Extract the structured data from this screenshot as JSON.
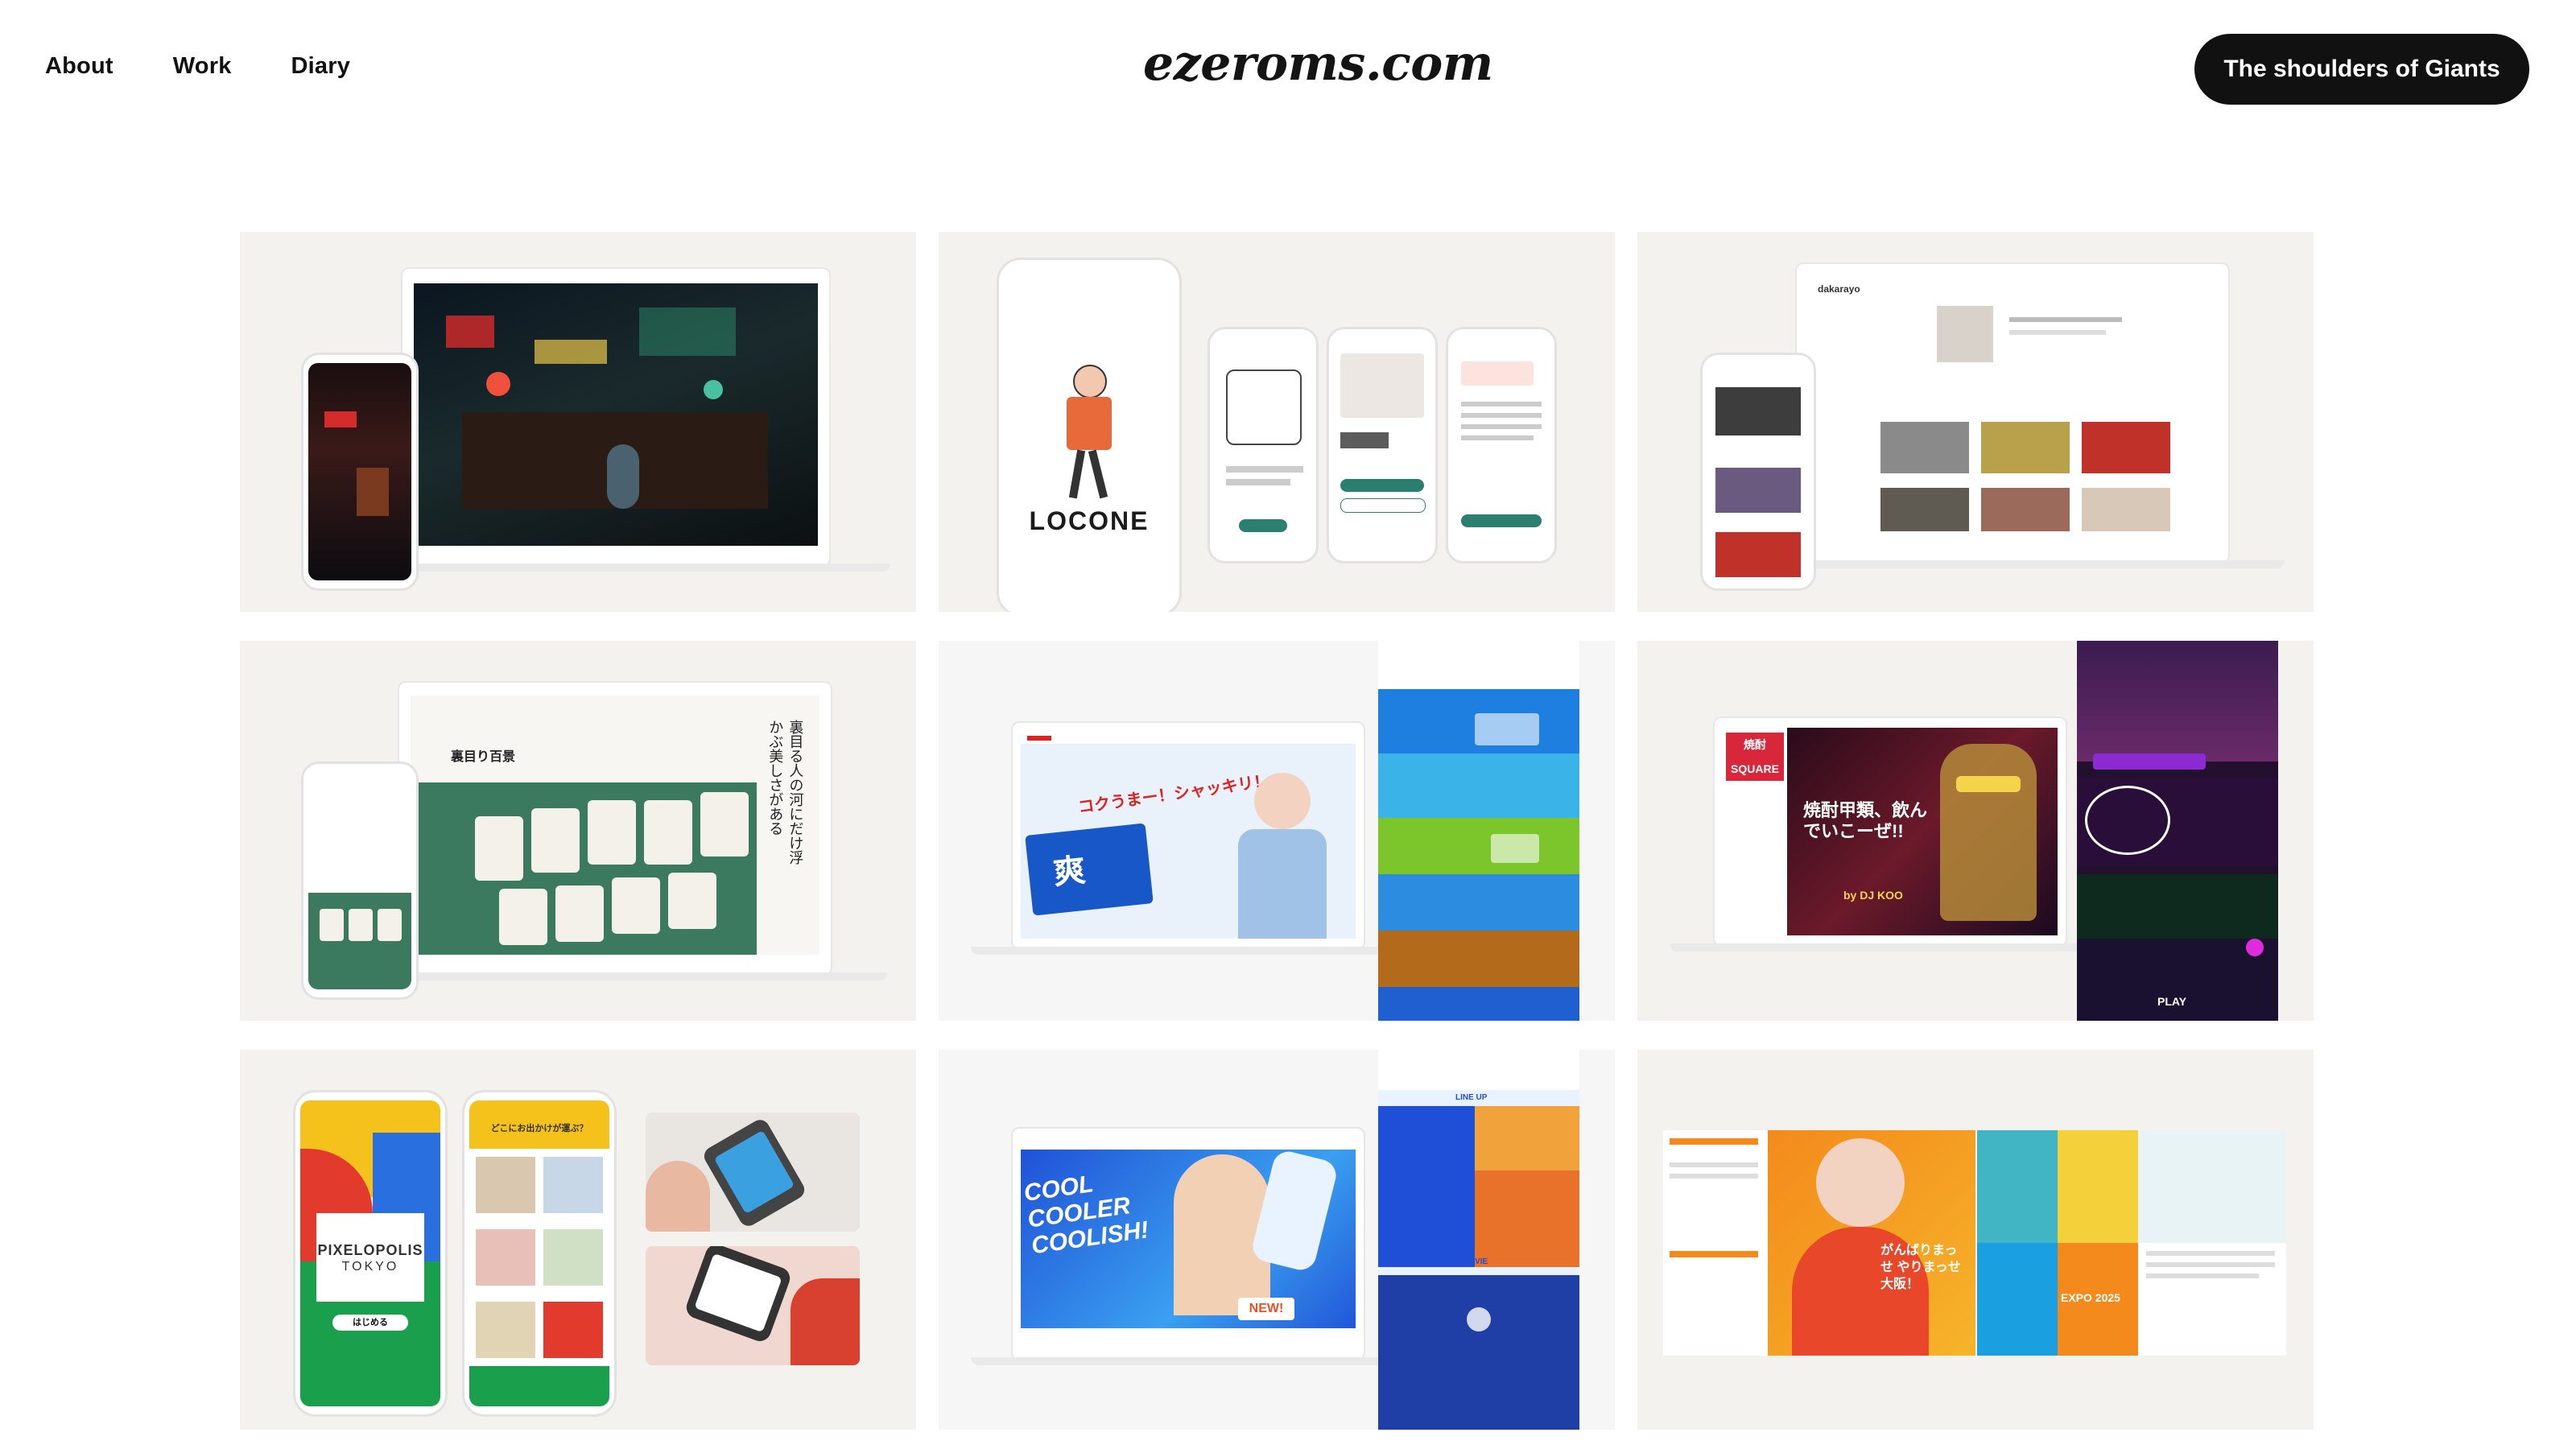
{
  "header": {
    "nav": [
      "About",
      "Work",
      "Diary"
    ],
    "logo": "ezeroms.com",
    "cta": "The shoulders of Giants"
  },
  "tiles": {
    "locone": {
      "title": "LOCONE"
    },
    "dakarayo": {
      "brand": "dakarayo"
    },
    "uramenu": {
      "title": "裏目り百景",
      "vertical": "裏目る人の河にだけ浮かぶ美しさがある"
    },
    "soh": {
      "headline": "コクうまー！シャッキリ！",
      "brand": "爽"
    },
    "shochu": {
      "title": "焼酎甲類、飲んでいこーぜ!!",
      "sub": "by DJ KOO",
      "side": "焼酎SQUARE",
      "badge": "PLAY"
    },
    "pixelopolis": {
      "title": "PIXELOPOLIS",
      "sub": "TOKYO",
      "button": "はじめる",
      "question": "どこにお出かけが運ぶ？"
    },
    "coolish": {
      "headline": "COOL COOLER COOLISH!",
      "badge": "NEW!",
      "lineup": "LINE UP",
      "movie": "MOVIE"
    },
    "osaka": {
      "slogan": "がんばりまっせ やりまっせ 大阪！",
      "expo": "EXPO 2025"
    }
  },
  "colors": {
    "tile_bg": "#f3f2ee",
    "cta_bg": "#111111",
    "soh_blue": "#1857c8",
    "coolish_blue": "#1f4fd6",
    "shochu_red": "#d8263a",
    "osaka_orange": "#f38a1b"
  }
}
